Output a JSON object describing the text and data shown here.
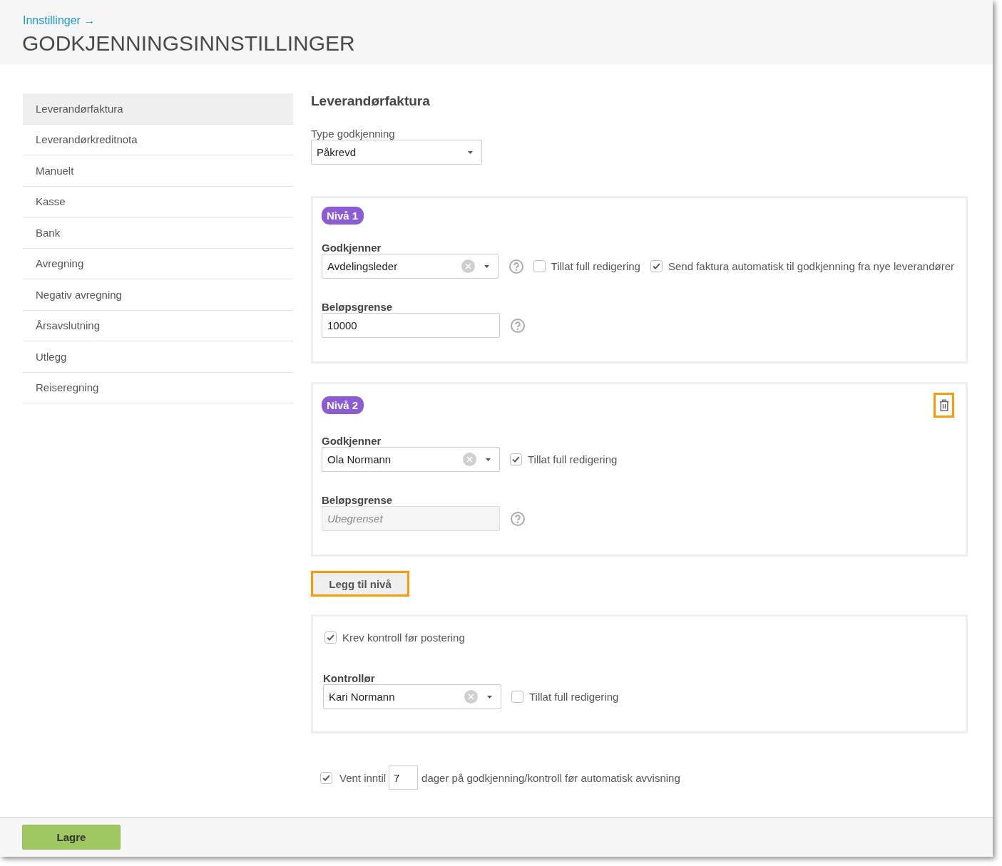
{
  "header": {
    "breadcrumb": "Innstillinger →",
    "title": "GODKJENNINGSINNSTILLINGER"
  },
  "sidebar": {
    "items": [
      {
        "label": "Leverandørfaktura",
        "selected": true
      },
      {
        "label": "Leverandørkreditnota",
        "selected": false
      },
      {
        "label": "Manuelt",
        "selected": false
      },
      {
        "label": "Kasse",
        "selected": false
      },
      {
        "label": "Bank",
        "selected": false
      },
      {
        "label": "Avregning",
        "selected": false
      },
      {
        "label": "Negativ avregning",
        "selected": false
      },
      {
        "label": "Årsavslutning",
        "selected": false
      },
      {
        "label": "Utlegg",
        "selected": false
      },
      {
        "label": "Reiseregning",
        "selected": false
      }
    ]
  },
  "content": {
    "heading": "Leverandørfaktura",
    "type_field": {
      "label": "Type godkjenning",
      "value": "Påkrevd",
      "clearable": false
    }
  },
  "levels": [
    {
      "badge": "Nivå 1",
      "approver": {
        "label": "Godkjenner",
        "value": "Avdelingsleder",
        "clearable": true,
        "help": true
      },
      "options": [
        {
          "label": "Tillat full redigering",
          "checked": false
        },
        {
          "label": "Send faktura automatisk til godkjenning fra nye leverandører",
          "checked": true
        }
      ],
      "amount": {
        "label": "Beløpsgrense",
        "value": "10000",
        "disabled": false,
        "help": true
      }
    },
    {
      "badge": "Nivå 2",
      "delete_button": {
        "highlighted": true
      },
      "approver": {
        "label": "Godkjenner",
        "value": "Ola Normann",
        "clearable": true,
        "help": false
      },
      "options": [
        {
          "label": "Tillat full redigering",
          "checked": true
        }
      ],
      "amount": {
        "label": "Beløpsgrense",
        "placeholder": "Ubegrenset",
        "disabled": true,
        "help": true
      }
    }
  ],
  "add_level_button": {
    "label": "Legg til nivå",
    "highlighted": true
  },
  "control": {
    "require": {
      "label": "Krev kontroll før postering",
      "checked": true
    },
    "controller": {
      "label": "Kontrollør",
      "value": "Kari Normann",
      "clearable": true
    },
    "options": [
      {
        "label": "Tillat full redigering",
        "checked": false
      }
    ]
  },
  "auto_reject": {
    "checked": true,
    "label_before": "Vent inntil",
    "days": "7",
    "label_after": "dager på godkjenning/kontroll før automatisk avvisning"
  },
  "footer": {
    "save_button": "Lagre"
  }
}
